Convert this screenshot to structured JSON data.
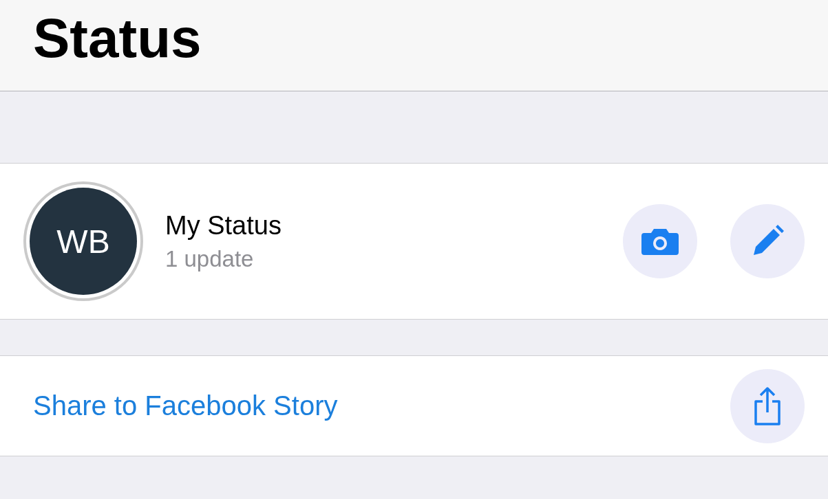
{
  "header": {
    "title": "Status"
  },
  "my_status": {
    "avatar_initials": "WB",
    "name": "My Status",
    "subtitle": "1 update"
  },
  "share": {
    "label": "Share to Facebook Story"
  }
}
